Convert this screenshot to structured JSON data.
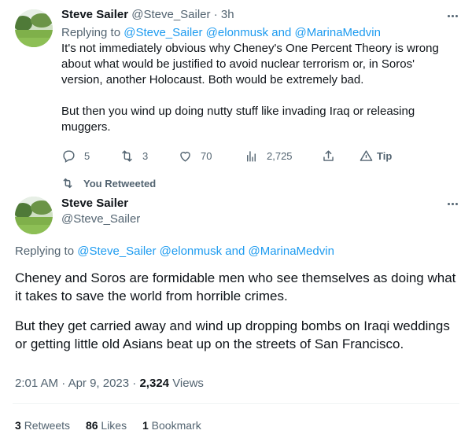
{
  "tweet1": {
    "name": "Steve Sailer",
    "handle": "@Steve_Sailer",
    "separator": "·",
    "time": "3h",
    "reply_prefix": "Replying to",
    "reply_handle_1": "@Steve_Sailer",
    "reply_handle_2": "@elonmusk",
    "reply_and": "and",
    "reply_handle_3": "@MarinaMedvin",
    "text_p1": "It's not immediately obvious why Cheney's One Percent Theory is wrong about what would be justified to avoid nuclear terrorism or, in Soros' version, another Holocaust. Both would be extremely bad.",
    "text_p2": "But then you wind up doing nutty stuff like invading Iraq or releasing muggers.",
    "actions": {
      "replies": "5",
      "retweets": "3",
      "likes": "70",
      "views": "2,725",
      "tip_label": "Tip"
    },
    "icons": [
      "reply-icon",
      "retweet-icon",
      "like-icon",
      "views-icon",
      "share-icon",
      "tip-icon",
      "more-icon"
    ]
  },
  "retweet_context": {
    "label": "You Retweeted"
  },
  "tweet2": {
    "name": "Steve Sailer",
    "handle": "@Steve_Sailer",
    "reply_prefix": "Replying to",
    "reply_handle_1": "@Steve_Sailer",
    "reply_handle_2": "@elonmusk",
    "reply_and": "and",
    "reply_handle_3": "@MarinaMedvin",
    "text_p1": "Cheney and Soros are formidable men who see themselves as doing what it takes to save the world from horrible crimes.",
    "text_p2": "But they get carried away and wind up dropping bombs on Iraqi weddings or getting little old Asians beat up on the streets of San Francisco.",
    "meta": {
      "time": "2:01 AM",
      "dot": "·",
      "date": "Apr 9, 2023",
      "views_count": "2,324",
      "views_label": "Views"
    },
    "stats": {
      "retweets_count": "3",
      "retweets_label": "Retweets",
      "likes_count": "86",
      "likes_label": "Likes",
      "bookmarks_count": "1",
      "bookmarks_label": "Bookmark"
    }
  },
  "colors": {
    "text": "#0f1419",
    "muted": "#536471",
    "link": "#1d9bf0",
    "divider": "#eff3f4"
  }
}
